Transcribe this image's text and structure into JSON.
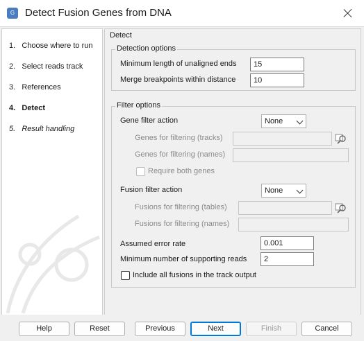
{
  "window": {
    "title": "Detect Fusion Genes from DNA",
    "app_icon_text": "G"
  },
  "steps": [
    {
      "number": "1.",
      "label": "Choose where to run"
    },
    {
      "number": "2.",
      "label": "Select reads track"
    },
    {
      "number": "3.",
      "label": "References"
    },
    {
      "number": "4.",
      "label": "Detect"
    },
    {
      "number": "5.",
      "label": "Result handling"
    }
  ],
  "panel": {
    "title": "Detect",
    "detection": {
      "legend": "Detection options",
      "min_unaligned_label": "Minimum length of unaligned ends",
      "min_unaligned_value": "15",
      "merge_label": "Merge breakpoints within distance",
      "merge_value": "10"
    },
    "filter": {
      "legend": "Filter options",
      "gene_action_label": "Gene filter action",
      "gene_action_value": "None",
      "genes_tracks_label": "Genes for filtering (tracks)",
      "genes_tracks_value": "",
      "genes_names_label": "Genes for filtering (names)",
      "genes_names_value": "",
      "require_both_label": "Require both genes",
      "fusion_action_label": "Fusion filter action",
      "fusion_action_value": "None",
      "fusions_tables_label": "Fusions for filtering (tables)",
      "fusions_tables_value": "",
      "fusions_names_label": "Fusions for filtering (names)",
      "fusions_names_value": "",
      "error_rate_label": "Assumed error rate",
      "error_rate_value": "0.001",
      "min_support_label": "Minimum number of supporting reads",
      "min_support_value": "2",
      "include_all_label": "Include all fusions in the track output"
    }
  },
  "buttons": {
    "help": "Help",
    "reset": "Reset",
    "previous": "Previous",
    "next": "Next",
    "finish": "Finish",
    "cancel": "Cancel"
  },
  "icons": {
    "close": "close-icon",
    "browse": "browse-icon",
    "dropdown": "chevron-down-icon"
  },
  "colors": {
    "accent": "#0078d7"
  }
}
